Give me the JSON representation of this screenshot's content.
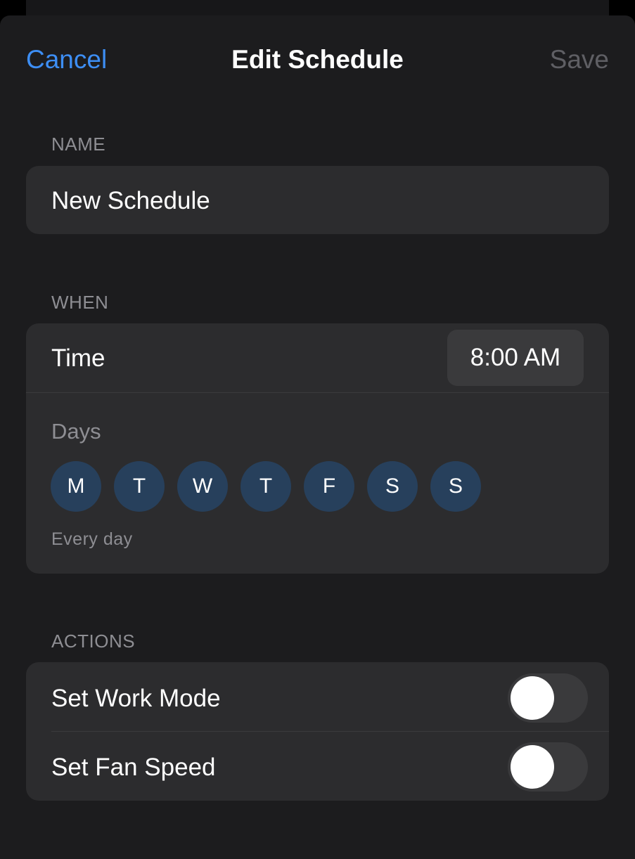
{
  "nav": {
    "cancel": "Cancel",
    "title": "Edit Schedule",
    "save": "Save"
  },
  "name_section": {
    "header": "NAME",
    "value": "New Schedule"
  },
  "when_section": {
    "header": "WHEN",
    "time_label": "Time",
    "time_value": "8:00 AM",
    "days_label": "Days",
    "days": [
      "M",
      "T",
      "W",
      "T",
      "F",
      "S",
      "S"
    ],
    "days_summary": "Every day"
  },
  "actions_section": {
    "header": "ACTIONS",
    "items": [
      {
        "label": "Set Work Mode",
        "enabled": false
      },
      {
        "label": "Set Fan Speed",
        "enabled": false
      }
    ]
  },
  "colors": {
    "accent": "#3d8ef4",
    "background": "#1c1c1e",
    "group": "#2c2c2e",
    "day_selected": "#27405c",
    "secondary_text": "#8e8e93"
  }
}
